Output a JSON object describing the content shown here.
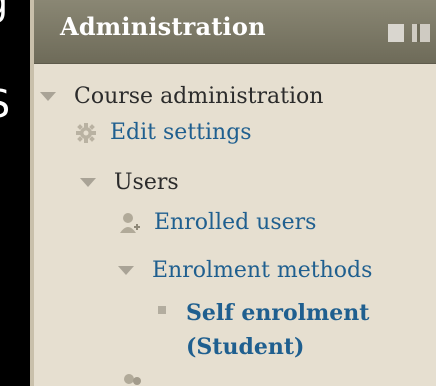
{
  "background_fragments": {
    "top_glyph": "g",
    "mid_glyph": "S"
  },
  "header": {
    "title": "Administration"
  },
  "tree": {
    "course_admin": "Course administration",
    "edit_settings": "Edit settings",
    "users": "Users",
    "enrolled_users": "Enrolled users",
    "enrolment_methods": "Enrolment methods",
    "self_enrolment_line1": "Self enrolment",
    "self_enrolment_line2": "(Student)"
  },
  "icons": {
    "settings": "gear-icon",
    "users": "user-add-icon",
    "next": "users-icon"
  },
  "colors": {
    "header": "#7a7766",
    "panel": "#e6dfd0",
    "link": "#1f5f8f"
  }
}
